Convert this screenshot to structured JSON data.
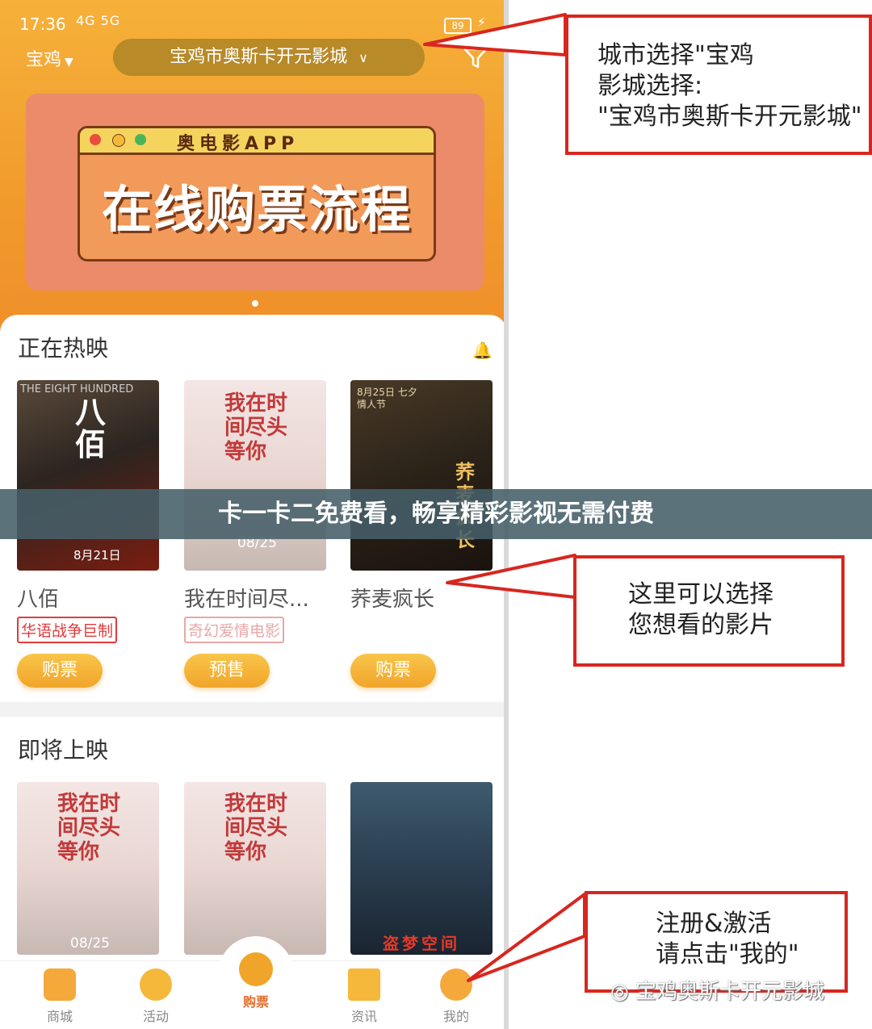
{
  "status_bar": {
    "time": "17:36",
    "signal": "4G  5G",
    "battery": "89"
  },
  "header": {
    "city": "宝鸡",
    "cinema": "宝鸡市奥斯卡开元影城"
  },
  "banner": {
    "app_name": "奥电影APP",
    "title": "在线购票流程"
  },
  "now_showing": {
    "title": "正在热映",
    "movies": [
      {
        "name": "八佰",
        "tag": "华语战争巨制",
        "button": "购票",
        "poster_title": "八佰",
        "poster_sub": "THE EIGHT HUNDRED",
        "poster_date": "8月21日"
      },
      {
        "name": "我在时间尽...",
        "tag": "奇幻爱情电影",
        "button": "预售",
        "poster_title": "我在时间尽头等你",
        "poster_date": "08/25"
      },
      {
        "name": "荞麦疯长",
        "tag": "",
        "button": "购票",
        "poster_title": "荞麦疯长",
        "poster_date": "8月25日 七夕情人节"
      }
    ]
  },
  "coming_soon": {
    "title": "即将上映",
    "movies": [
      {
        "poster_title": "我在时间尽头等你",
        "poster_date": "08/25"
      },
      {
        "poster_title": "我在时间尽头等你",
        "poster_date": ""
      },
      {
        "poster_title": "盗梦空间",
        "poster_date": ""
      }
    ]
  },
  "tabs": [
    {
      "label": "商城",
      "icon": "store-icon"
    },
    {
      "label": "活动",
      "icon": "activity-icon"
    },
    {
      "label": "购票",
      "icon": "film-reel-icon"
    },
    {
      "label": "资讯",
      "icon": "news-icon"
    },
    {
      "label": "我的",
      "icon": "profile-icon"
    }
  ],
  "overlay_title": "卡一卡二免费看，畅享精彩影视无需付费",
  "callouts": {
    "city": [
      "城市选择\"宝鸡",
      "影城选择:",
      "\"宝鸡市奥斯卡开元影城\""
    ],
    "movie": [
      "这里可以选择",
      "您想看的影片"
    ],
    "register": [
      "注册&激活",
      "请点击\"我的\""
    ]
  },
  "watermark": "宝鸡奥斯卡开元影城",
  "colors": {
    "accent": "#f0a52a",
    "callout_border": "#d8261f",
    "tag_red": "#e23b3b"
  }
}
